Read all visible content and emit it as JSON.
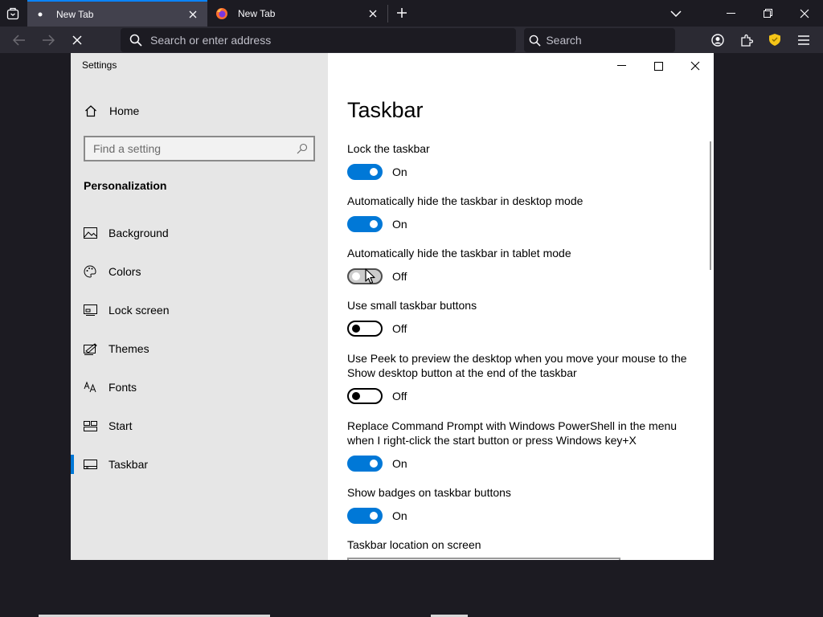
{
  "browser": {
    "tabs": [
      {
        "title": "New Tab",
        "active": true,
        "icon": "dot-icon"
      },
      {
        "title": "New Tab",
        "active": false,
        "icon": "firefox-icon"
      }
    ],
    "address_placeholder": "Search or enter address",
    "search_placeholder": "Search",
    "accent": "#0a84ff"
  },
  "settings": {
    "window_title": "Settings",
    "home_label": "Home",
    "find_placeholder": "Find a setting",
    "section_label": "Personalization",
    "nav": [
      {
        "label": "Background",
        "icon": "picture-icon",
        "selected": false
      },
      {
        "label": "Colors",
        "icon": "palette-icon",
        "selected": false
      },
      {
        "label": "Lock screen",
        "icon": "lock-screen-icon",
        "selected": false
      },
      {
        "label": "Themes",
        "icon": "themes-icon",
        "selected": false
      },
      {
        "label": "Fonts",
        "icon": "fonts-icon",
        "selected": false
      },
      {
        "label": "Start",
        "icon": "start-icon",
        "selected": false
      },
      {
        "label": "Taskbar",
        "icon": "taskbar-icon",
        "selected": true
      }
    ],
    "page_title": "Taskbar",
    "options": [
      {
        "label": "Lock the taskbar",
        "state": "On"
      },
      {
        "label": "Automatically hide the taskbar in desktop mode",
        "state": "On"
      },
      {
        "label": "Automatically hide the taskbar in tablet mode",
        "state": "Off"
      },
      {
        "label": "Use small taskbar buttons",
        "state": "Off"
      },
      {
        "label": "Use Peek to preview the desktop when you move your mouse to the Show desktop button at the end of the taskbar",
        "state": "Off"
      },
      {
        "label": "Replace Command Prompt with Windows PowerShell in the menu when I right-click the start button or press Windows key+X",
        "state": "On"
      },
      {
        "label": "Show badges on taskbar buttons",
        "state": "On"
      }
    ],
    "location_label": "Taskbar location on screen",
    "accent": "#0078d7"
  }
}
